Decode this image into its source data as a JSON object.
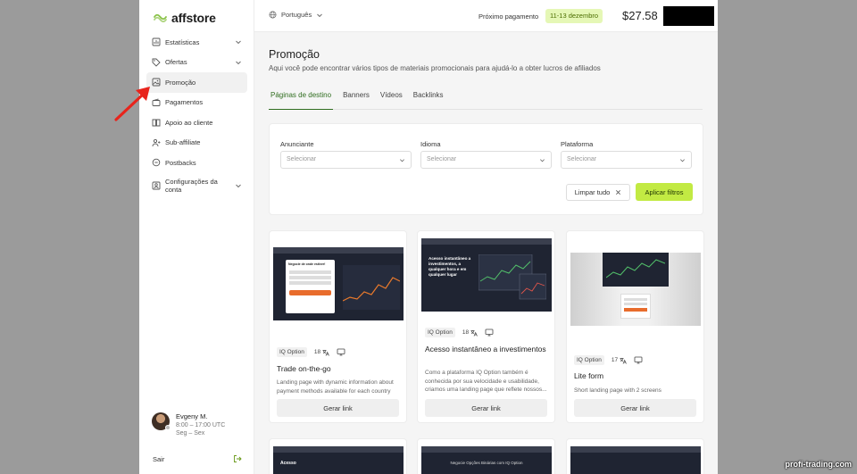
{
  "brand": {
    "name": "affstore",
    "accent": "#c2ea43",
    "logo_color": "#8bc34a"
  },
  "sidebar": {
    "items": [
      {
        "label": "Estatísticas",
        "icon": "chart-icon",
        "has_chevron": true
      },
      {
        "label": "Ofertas",
        "icon": "tag-icon",
        "has_chevron": true
      },
      {
        "label": "Promoção",
        "icon": "image-icon",
        "has_chevron": false,
        "active": true
      },
      {
        "label": "Pagamentos",
        "icon": "wallet-icon",
        "has_chevron": false
      },
      {
        "label": "Apoio ao cliente",
        "icon": "book-icon",
        "has_chevron": false
      },
      {
        "label": "Sub-affiliate",
        "icon": "users-icon",
        "has_chevron": false
      },
      {
        "label": "Postbacks",
        "icon": "link-icon",
        "has_chevron": false
      },
      {
        "label": "Configurações da conta",
        "icon": "account-icon",
        "has_chevron": true
      }
    ],
    "user": {
      "name": "Evgeny M.",
      "hours": "8:00 – 17:00 UTC",
      "days": "Seg – Sex"
    },
    "logout_label": "Sair"
  },
  "header": {
    "language": "Português",
    "payment_label": "Próximo pagamento",
    "payment_dates": "11-13 dezembro",
    "balance": "$27.58"
  },
  "main": {
    "title": "Promoção",
    "subtitle": "Aqui você pode encontrar vários tipos de materiais promocionais para ajudá-lo a obter lucros de afiliados",
    "tabs": [
      {
        "label": "Páginas de destino",
        "active": true
      },
      {
        "label": "Banners",
        "active": false
      },
      {
        "label": "Vídeos",
        "active": false
      },
      {
        "label": "Backlinks",
        "active": false
      }
    ],
    "filters": {
      "advertiser": {
        "label": "Anunciante",
        "placeholder": "Selecionar"
      },
      "language": {
        "label": "Idioma",
        "placeholder": "Selecionar"
      },
      "platform": {
        "label": "Plataforma",
        "placeholder": "Selecionar"
      },
      "clear_label": "Limpar tudo",
      "apply_label": "Aplicar filtros"
    },
    "cards": [
      {
        "advertiser": "IQ Option",
        "languages": "18",
        "title": "Trade on-the-go",
        "description": "Landing page with dynamic information about payment methods available for each country",
        "button": "Gerar link",
        "thumb_text": "Negocie de onde estiver!"
      },
      {
        "advertiser": "IQ Option",
        "languages": "18",
        "title": "Acesso instantâneo a investimentos",
        "description": "Como a plataforma IQ Option também é conhecida por sua velocidade e usabilidade, criamos uma landing page que reflete nossos...",
        "button": "Gerar link",
        "thumb_text": "Acesso instantâneo a investimentos, a qualquer hora e em qualquer lugar"
      },
      {
        "advertiser": "IQ Option",
        "languages": "17",
        "title": "Lite form",
        "description": "Short landing page with 2 screens",
        "button": "Gerar link",
        "thumb_text": ""
      }
    ],
    "bottom_cards": [
      {
        "thumb_text": "Acesso"
      },
      {
        "thumb_text": "Negocie Opções Binárias com IQ Option"
      },
      {
        "thumb_text": ""
      }
    ]
  },
  "watermark": "profi-trading.com"
}
